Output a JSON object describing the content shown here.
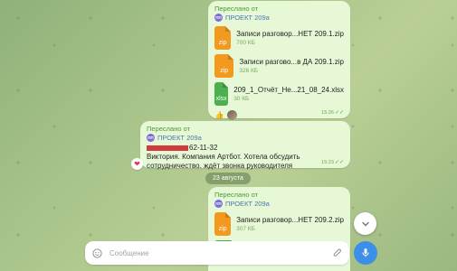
{
  "messages": [
    {
      "forwarded_label": "Переслано от",
      "source_name": "ПРОЕКТ 209а",
      "source_initials": "ПП",
      "files": [
        {
          "type": "zip",
          "name": "Записи разговор...НЕТ 209.1.zip",
          "size": "700 КБ"
        },
        {
          "type": "zip",
          "name": "Записи разгово...в ДА 209.1.zip",
          "size": "326 КБ"
        },
        {
          "type": "xlsx",
          "name": "209_1_Отчёт_Не...21_08_24.xlsx",
          "size": "30 КБ"
        }
      ],
      "reaction_emoji": "👍",
      "time": "15:26"
    },
    {
      "forwarded_label": "Переслано от",
      "source_name": "ПРОЕКТ 209а",
      "source_initials": "ПП",
      "phone_suffix": "62-11-32",
      "text": "Виктория. Компания Артбот. Хотела обсудить сотрудничество. ждёт звонка руководителя",
      "time": "15:23"
    },
    {
      "forwarded_label": "Переслано от",
      "source_name": "ПРОЕКТ 209а",
      "source_initials": "ПП",
      "files": [
        {
          "type": "zip",
          "name": "Записи разговор...НЕТ 209.2.zip",
          "size": "307 КБ"
        }
      ]
    }
  ],
  "date_separator": "23 августа",
  "composer": {
    "placeholder": "Сообщение"
  },
  "colors": {
    "bubble": "#e6f8d5",
    "zip": "#f39a1e",
    "xlsx": "#4caf50",
    "accent": "#3d8ee6",
    "redaction": "#d23b3b"
  }
}
